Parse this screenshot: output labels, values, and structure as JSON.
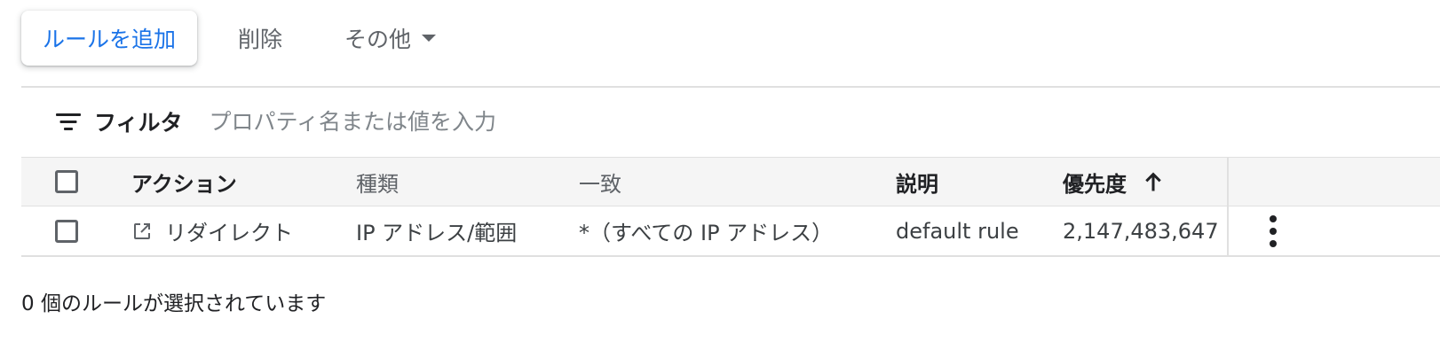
{
  "toolbar": {
    "add_rule_label": "ルールを追加",
    "delete_label": "削除",
    "more_label": "その他"
  },
  "filter": {
    "label": "フィルタ",
    "placeholder": "プロパティ名または値を入力",
    "value": ""
  },
  "table": {
    "columns": {
      "action": "アクション",
      "type": "種類",
      "match": "一致",
      "description": "説明",
      "priority": "優先度"
    },
    "sort": {
      "column": "priority",
      "direction": "ascending"
    },
    "rows": [
      {
        "checked": false,
        "action": "リダイレクト",
        "action_icon": "open-in-new-icon",
        "type": "IP アドレス/範囲",
        "match": "*（すべての IP アドレス）",
        "description": "default rule",
        "priority": "2,147,483,647"
      }
    ]
  },
  "status_text": "0 個のルールが選択されています",
  "colors": {
    "accent": "#1a73e8",
    "header_bg": "#f5f5f5",
    "divider": "#e0e0e0",
    "muted_text": "#5f6368"
  }
}
